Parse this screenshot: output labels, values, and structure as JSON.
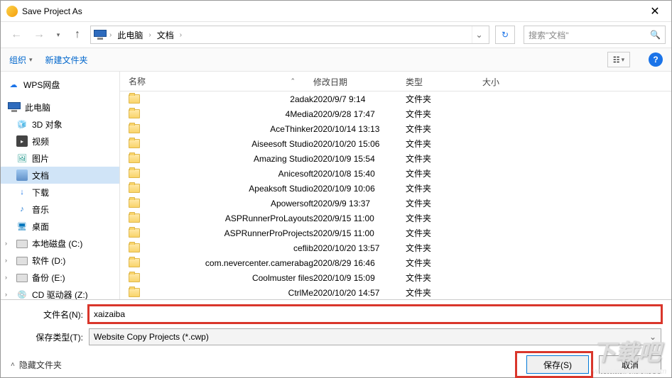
{
  "title": "Save Project As",
  "breadcrumb": {
    "root": "此电脑",
    "current": "文档"
  },
  "search": {
    "placeholder": "搜索\"文档\""
  },
  "toolbar": {
    "organize": "组织",
    "newfolder": "新建文件夹"
  },
  "sidebar": {
    "wps": "WPS网盘",
    "pc": "此电脑",
    "obj3d": "3D 对象",
    "video": "视频",
    "pictures": "图片",
    "documents": "文档",
    "downloads": "下载",
    "music": "音乐",
    "desktop": "桌面",
    "localC": "本地磁盘 (C:)",
    "softD": "软件 (D:)",
    "backupE": "备份 (E:)",
    "cdrom": "CD 驱动器 (Z:)"
  },
  "columns": {
    "name": "名称",
    "date": "修改日期",
    "type": "类型",
    "size": "大小"
  },
  "typelabel": "文件夹",
  "files": [
    {
      "name": "2adak",
      "date": "2020/9/7 9:14"
    },
    {
      "name": "4Media",
      "date": "2020/9/28 17:47"
    },
    {
      "name": "AceThinker",
      "date": "2020/10/14 13:13"
    },
    {
      "name": "Aiseesoft Studio",
      "date": "2020/10/20 15:06"
    },
    {
      "name": "Amazing Studio",
      "date": "2020/10/9 15:54"
    },
    {
      "name": "Anicesoft",
      "date": "2020/10/8 15:40"
    },
    {
      "name": "Apeaksoft Studio",
      "date": "2020/10/9 10:06"
    },
    {
      "name": "Apowersoft",
      "date": "2020/9/9 13:37"
    },
    {
      "name": "ASPRunnerProLayouts",
      "date": "2020/9/15 11:00"
    },
    {
      "name": "ASPRunnerProProjects",
      "date": "2020/9/15 11:00"
    },
    {
      "name": "ceflib",
      "date": "2020/10/20 13:57"
    },
    {
      "name": "com.nevercenter.camerabag",
      "date": "2020/8/29 16:46"
    },
    {
      "name": "Coolmuster files",
      "date": "2020/10/9 15:09"
    },
    {
      "name": "CtrlMe",
      "date": "2020/10/20 14:57"
    }
  ],
  "form": {
    "filename_label": "文件名(N):",
    "filename_value": "xaizaiba",
    "filetype_label": "保存类型(T):",
    "filetype_value": "Website Copy Projects (*.cwp)"
  },
  "actions": {
    "hidefolders": "隐藏文件夹",
    "save": "保存(S)",
    "cancel": "取消"
  },
  "watermark": {
    "text": "下载吧",
    "url": "www.xiazaiba.com"
  }
}
